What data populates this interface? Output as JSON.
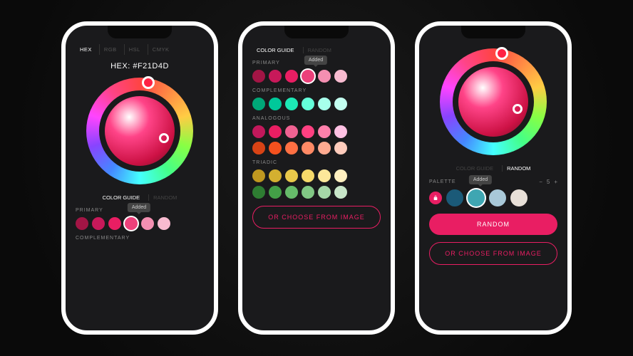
{
  "screen1": {
    "format_tabs": [
      "HEX",
      "RGB",
      "HSL",
      "CMYK"
    ],
    "active_format": "HEX",
    "hex_value": "HEX: #F21D4D",
    "subtabs": [
      "COLOR GUIDE",
      "RANDOM"
    ],
    "active_subtab": "COLOR GUIDE",
    "primary_label": "PRIMARY",
    "complementary_label": "COMPLEMENTARY",
    "tooltip_text": "Added",
    "primary_swatches": [
      "#a31545",
      "#c8195a",
      "#e91e63",
      "#ec407a",
      "#f48fb1",
      "#f8bbd0"
    ]
  },
  "screen2": {
    "subtabs": [
      "COLOR GUIDE",
      "RANDOM"
    ],
    "active_subtab": "COLOR GUIDE",
    "tooltip_text": "Added",
    "sections": {
      "primary": {
        "label": "PRIMARY",
        "colors": [
          "#a31545",
          "#c8195a",
          "#e91e63",
          "#ec407a",
          "#f48fb1",
          "#f8bbd0"
        ]
      },
      "complementary": {
        "label": "COMPLEMENTARY",
        "colors": [
          "#00a878",
          "#00c89a",
          "#1de9b6",
          "#64ffda",
          "#a7ffeb",
          "#c3fff0"
        ]
      },
      "analogous": {
        "label": "ANALOGOUS",
        "row1": [
          "#c2185b",
          "#e91e63",
          "#f06292",
          "#ff4081",
          "#ff80ab",
          "#ffc1e3"
        ],
        "row2": [
          "#d84315",
          "#f4511e",
          "#ff7043",
          "#ff8a65",
          "#ffab91",
          "#ffccbc"
        ]
      },
      "triadic": {
        "label": "TRIADIC",
        "row1": [
          "#c09820",
          "#d4b030",
          "#e8c84a",
          "#f5d96a",
          "#fde89a",
          "#fff0c0"
        ],
        "row2": [
          "#2e7d32",
          "#43a047",
          "#66bb6a",
          "#81c784",
          "#a5d6a7",
          "#c8e6c9"
        ]
      }
    },
    "button_label": "OR CHOOSE FROM IMAGE"
  },
  "screen3": {
    "subtabs": [
      "COLOR GUIDE",
      "RANDOM"
    ],
    "active_subtab": "RANDOM",
    "palette_label": "PALETTE",
    "tooltip_text": "Added",
    "counter_value": "5",
    "palette": [
      "#e91e63",
      "#1b5a78",
      "#3fa6b2",
      "#a8c8d8",
      "#e8e0d8"
    ],
    "random_btn": "RANDOM",
    "image_btn": "OR CHOOSE FROM IMAGE"
  }
}
